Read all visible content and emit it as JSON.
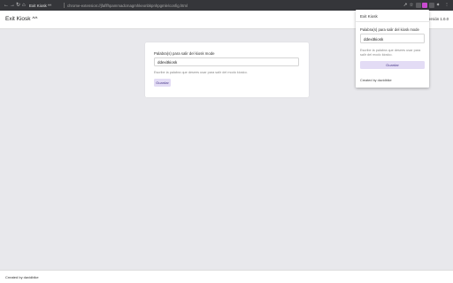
{
  "browser": {
    "tab_title": "Exit Kiosk ^^",
    "url": "chrome-extension://jfaflfhpammadcmagmhkeonbkpnhpgmle/config.html",
    "icons": {
      "back": "arrow-left-icon",
      "forward": "arrow-right-icon",
      "reload": "reload-icon",
      "home": "home-icon",
      "share": "share-icon",
      "bookmark": "star-icon",
      "extensions": "puzzle-icon",
      "menu": "kebab-menu-icon"
    }
  },
  "header": {
    "title": "Exit Kiosk ^^",
    "version": "Versión 1.0.0"
  },
  "main_form": {
    "label": "Palabra(s) para salir del kiosk mode",
    "input_value": "ddexitkiosk",
    "help_text": "Escribe la palabra que desees usar para salir del modo kiosko.",
    "save_label": "Guardar"
  },
  "footer": {
    "created_by": "Created by davidbike"
  },
  "popup": {
    "title": "Exit Kiosk",
    "label": "Palabra(s) para salir del kiosk mode",
    "input_value": "ddexitkiosk",
    "help_text": "Escribe la palabra que desees usar para salir del modo kiosko.",
    "save_label": "Guardar",
    "created_by": "Created by davidbike"
  },
  "colors": {
    "chrome_bar": "#35363a",
    "page_background": "#e8e8ec",
    "button_bg": "#e3dcf5",
    "button_text": "#4a3a8a",
    "extension_active": "#c94bd0"
  }
}
